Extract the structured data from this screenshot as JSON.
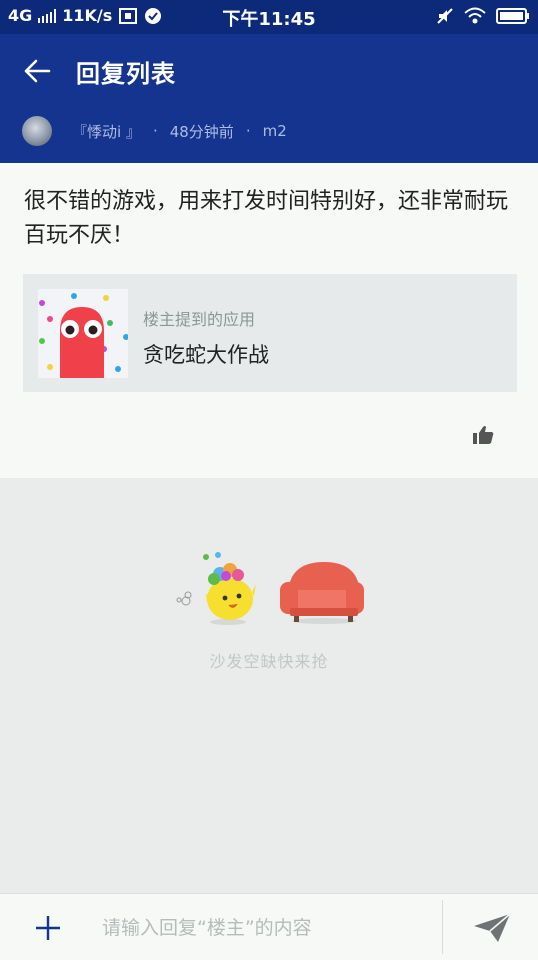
{
  "status_bar": {
    "network": "4G",
    "speed": "11K/s",
    "time": "下午11:45"
  },
  "header": {
    "title": "回复列表",
    "author": "『悸动i 』",
    "separator": "·",
    "time_ago": "48分钟前",
    "device": "m2"
  },
  "reply": {
    "content": "很不错的游戏，用来打发时间特别好，还非常耐玩百玩不厌！",
    "app_mention_label": "楼主提到的应用",
    "app_name": "贪吃蛇大作战"
  },
  "empty_state": {
    "text": "沙发空缺快来抢"
  },
  "composer": {
    "placeholder": "请输入回复“楼主”的内容"
  },
  "colors": {
    "header_bg": "#14348f",
    "status_bg": "#0d2a7a",
    "card_bg": "#f6f9f6",
    "page_bg": "#e9ecea"
  }
}
